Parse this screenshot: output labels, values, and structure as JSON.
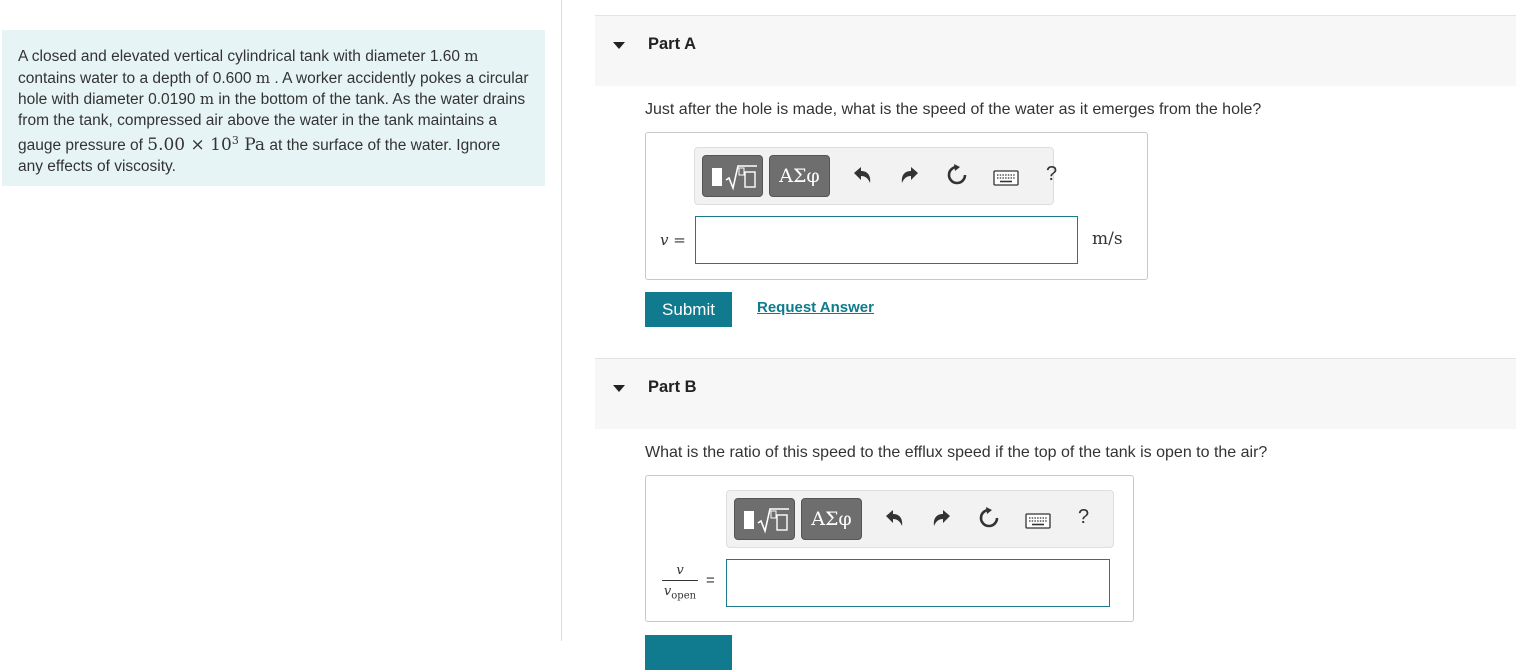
{
  "problem": {
    "segments": [
      "A closed and elevated vertical cylindrical tank with diameter 1.60 ",
      "m",
      " contains water to a depth of 0.600 ",
      "m",
      " . A worker accidently pokes a circular hole with diameter 0.0190 ",
      "m",
      " in the bottom of the tank. As the water drains from the tank, compressed air above the water in the tank maintains a gauge pressure of ",
      "5.00 × 10",
      "3",
      " Pa",
      " at the surface of the water. Ignore any effects of viscosity."
    ]
  },
  "partA": {
    "title": "Part A",
    "question": "Just after the hole is made, what is the speed of the water as it emerges from the hole?",
    "var_label": "v =",
    "unit": "m/s",
    "greek_label": "ΑΣφ",
    "help_label": "?",
    "submit_label": "Submit",
    "request_label": "Request Answer"
  },
  "partB": {
    "title": "Part B",
    "question": "What is the ratio of this speed to the efflux speed if the top of the tank is open to the air?",
    "frac_num": "v",
    "frac_den": "v",
    "frac_den_sub": "open",
    "equals": "=",
    "greek_label": "ΑΣφ",
    "help_label": "?"
  },
  "colors": {
    "accent": "#107a8e",
    "panel_bg": "#e6f4f6",
    "header_bg": "#f7f7f7"
  }
}
